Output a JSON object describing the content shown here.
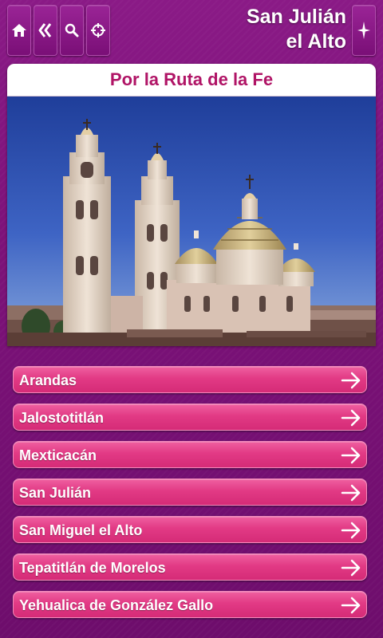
{
  "header": {
    "title_line1": "San Julián",
    "title_line2": "el Alto",
    "buttons": [
      {
        "name": "home-button",
        "icon": "home-icon"
      },
      {
        "name": "back-button",
        "icon": "double-chevron-left-icon"
      },
      {
        "name": "search-button",
        "icon": "magnifier-icon"
      },
      {
        "name": "locate-button",
        "icon": "crosshair-icon"
      },
      {
        "name": "compass-button",
        "icon": "compass-icon"
      }
    ]
  },
  "section": {
    "title": "Por la Ruta de la Fe",
    "image": "cathedral-photo"
  },
  "list": {
    "items": [
      {
        "label": "Arandas"
      },
      {
        "label": "Jalostotitlán"
      },
      {
        "label": "Mexticacán"
      },
      {
        "label": "San Julián"
      },
      {
        "label": "San Miguel el Alto"
      },
      {
        "label": "Tepatitlán de Morelos"
      },
      {
        "label": "Yehualica de González Gallo"
      }
    ],
    "arrow_icon": "arrow-right-icon"
  },
  "colors": {
    "background": "#7c1279",
    "title_text": "#b01466",
    "list_item": "#e23a85"
  }
}
